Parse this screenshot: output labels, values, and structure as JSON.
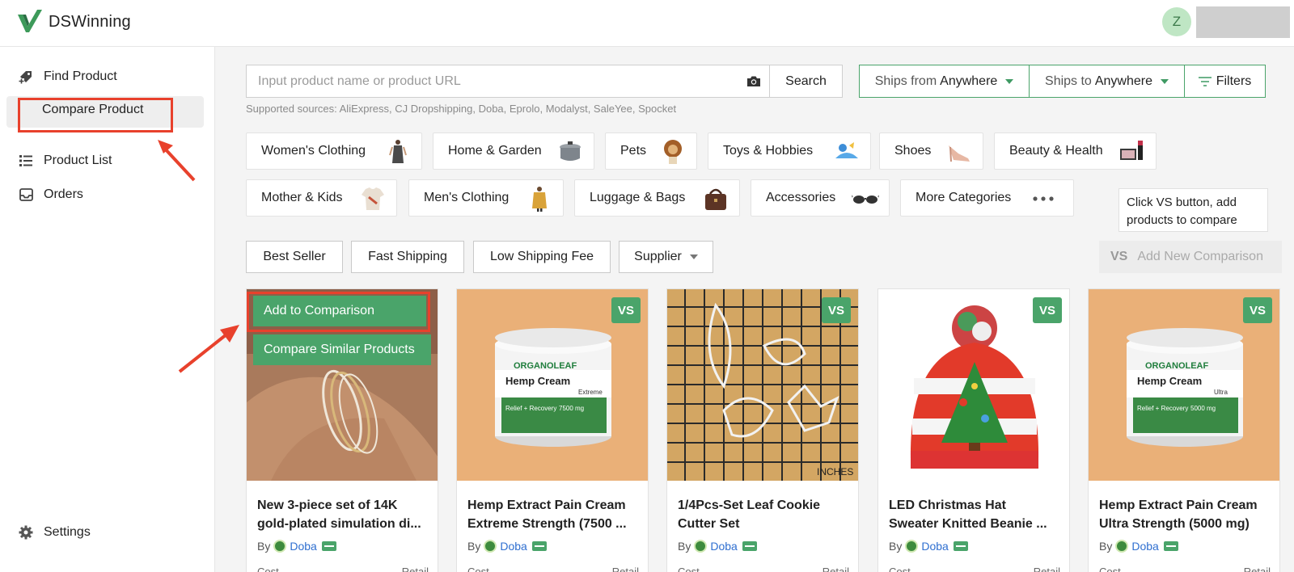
{
  "header": {
    "brand": "DSWinning",
    "avatar_initial": "Z"
  },
  "sidebar": {
    "items": [
      {
        "label": "Find Product",
        "icon": "tag-plus-icon"
      },
      {
        "label": "Compare Product",
        "icon": "compare-icon"
      },
      {
        "label": "Product List",
        "icon": "list-icon"
      },
      {
        "label": "Orders",
        "icon": "inbox-icon"
      }
    ],
    "settings_label": "Settings"
  },
  "search": {
    "placeholder": "Input product name or product URL",
    "button": "Search",
    "sources": "Supported sources: AliExpress, CJ Dropshipping, Doba, Eprolo, Modalyst, SaleYee, Spocket"
  },
  "shipping": {
    "from_label": "Ships from",
    "from_value": "Anywhere",
    "to_label": "Ships to",
    "to_value": "Anywhere",
    "filters_label": "Filters"
  },
  "categories": [
    "Women's Clothing",
    "Home & Garden",
    "Pets",
    "Toys & Hobbies",
    "Shoes",
    "Beauty & Health",
    "Mother & Kids",
    "Men's Clothing",
    "Luggage & Bags",
    "Accessories",
    "More Categories"
  ],
  "tooltip": {
    "line1": "Click VS button, add",
    "line2": "products to compare"
  },
  "filters": [
    "Best Seller",
    "Fast Shipping",
    "Low Shipping Fee",
    "Supplier"
  ],
  "add_comparison": {
    "vs": "VS",
    "label": "Add New Comparison"
  },
  "overlay": {
    "add": "Add to Comparison",
    "compare_similar": "Compare Similar Products"
  },
  "cards": [
    {
      "title1": "New 3-piece set of 14K",
      "title2": "gold-plated simulation di...",
      "supplier": "Doba"
    },
    {
      "title1": "Hemp Extract Pain Cream",
      "title2": "Extreme Strength (7500 ...",
      "supplier": "Doba",
      "vs": "VS"
    },
    {
      "title1": "1/4Pcs-Set Leaf Cookie",
      "title2": "Cutter Set",
      "supplier": "Doba",
      "vs": "VS"
    },
    {
      "title1": "LED Christmas Hat",
      "title2": "Sweater Knitted Beanie ...",
      "supplier": "Doba",
      "vs": "VS"
    },
    {
      "title1": "Hemp Extract Pain Cream",
      "title2": "Ultra Strength (5000 mg)",
      "supplier": "Doba",
      "vs": "VS"
    }
  ],
  "card_labels": {
    "by": "By",
    "cost": "Cost",
    "retail": "Retail"
  },
  "product_art": {
    "cream1_brand": "ORGANOLEAF",
    "cream1_name": "Hemp Cream",
    "cream1_strength": "Extreme",
    "cream1_mg": "7500 mg",
    "cream2_mg": "5000 mg",
    "cream2_strength": "Ultra",
    "relief": "Relief + Recovery",
    "inches": "INCHES"
  },
  "colors": {
    "accent": "#4aa46a",
    "highlight": "#e8412c"
  }
}
